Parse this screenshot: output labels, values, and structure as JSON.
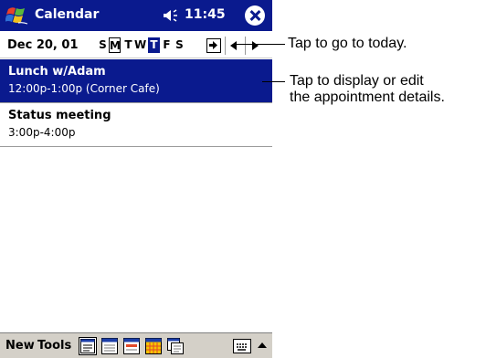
{
  "titlebar": {
    "app_title": "Calendar",
    "clock": "11:45",
    "accent_color": "#0a1a8e",
    "start_icon": "windows-flag-icon",
    "speaker_icon": "speaker-icon",
    "close_icon": "close-icon"
  },
  "datebar": {
    "date": "Dec 20, 01",
    "weekdays": [
      {
        "label": "S",
        "state": "normal"
      },
      {
        "label": "M",
        "state": "boxed"
      },
      {
        "label": "T",
        "state": "normal"
      },
      {
        "label": "W",
        "state": "normal"
      },
      {
        "label": "T",
        "state": "selected"
      },
      {
        "label": "F",
        "state": "normal"
      },
      {
        "label": "S",
        "state": "normal"
      }
    ],
    "today_icon": "go-to-today-icon",
    "prev_icon": "arrow-left-icon",
    "next_icon": "arrow-right-icon"
  },
  "appointments": [
    {
      "title": "Lunch w/Adam",
      "details": "12:00p-1:00p (Corner Cafe)",
      "selected": true
    },
    {
      "title": "Status meeting",
      "details": "3:00p-4:00p",
      "selected": false
    }
  ],
  "toolbar": {
    "new_label": "New",
    "tools_label": "Tools",
    "views": [
      "agenda-view-icon",
      "day-view-icon",
      "week-view-icon",
      "month-view-icon",
      "year-view-icon"
    ],
    "keyboard_icon": "keyboard-icon",
    "sip_arrow_icon": "caret-up-icon"
  },
  "callouts": {
    "today": "Tap to go to today.",
    "details_line1": "Tap to display or edit",
    "details_line2": "the appointment details."
  }
}
